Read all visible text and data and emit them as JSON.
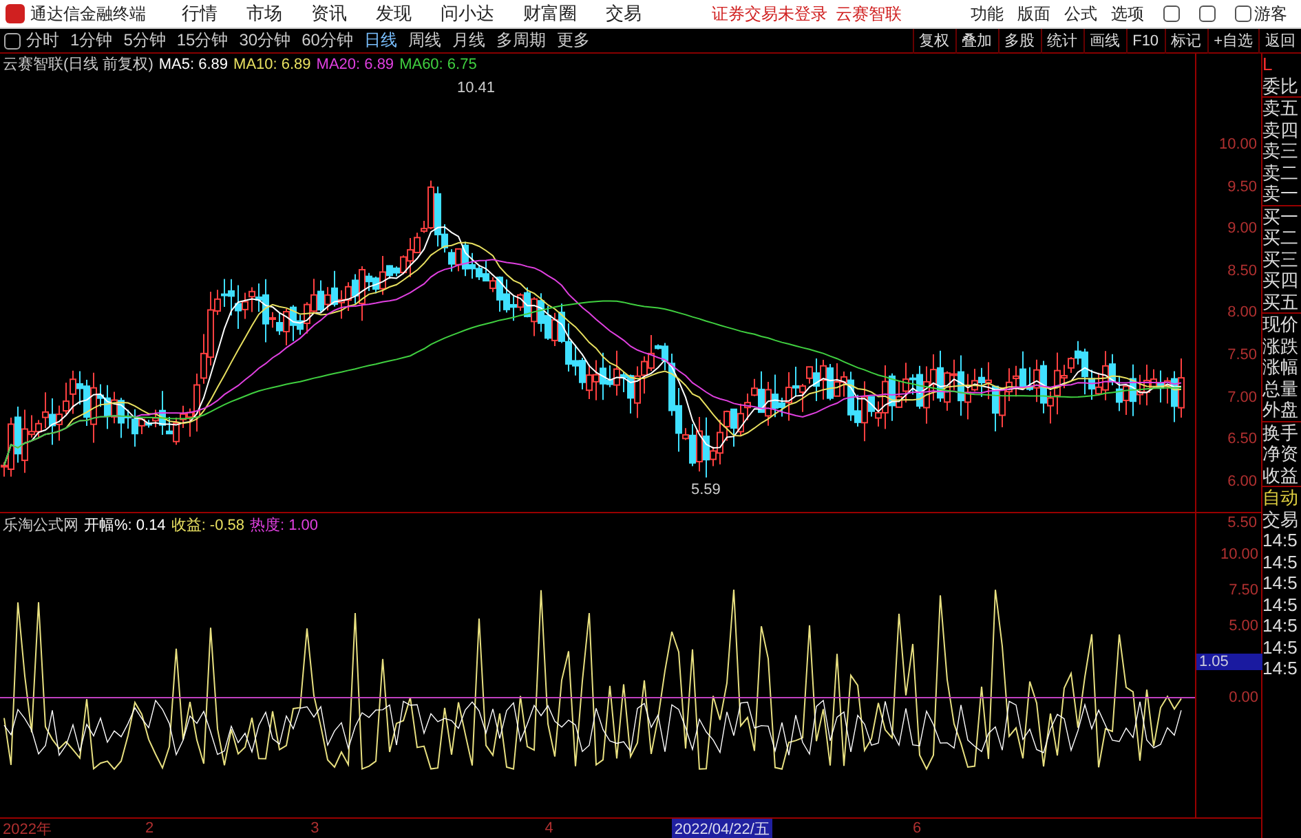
{
  "app": {
    "title": "通达信金融终端",
    "menu": [
      "行情",
      "市场",
      "资讯",
      "发现",
      "问小达",
      "财富圈",
      "交易"
    ],
    "notices": [
      "证券交易未登录",
      "云赛智联"
    ],
    "tools": [
      "功能",
      "版面",
      "公式",
      "选项"
    ],
    "user": "游客"
  },
  "toolbar": {
    "periods": [
      {
        "label": "分时",
        "selected": false
      },
      {
        "label": "1分钟",
        "selected": false
      },
      {
        "label": "5分钟",
        "selected": false
      },
      {
        "label": "15分钟",
        "selected": false
      },
      {
        "label": "30分钟",
        "selected": false
      },
      {
        "label": "60分钟",
        "selected": false
      },
      {
        "label": "日线",
        "selected": true
      },
      {
        "label": "周线",
        "selected": false
      },
      {
        "label": "月线",
        "selected": false
      },
      {
        "label": "多周期",
        "selected": false
      },
      {
        "label": "更多",
        "selected": false
      }
    ],
    "actions": [
      "复权",
      "叠加",
      "多股",
      "统计",
      "画线",
      "F10",
      "标记",
      "+自选",
      "返回"
    ]
  },
  "main_chart": {
    "title": "云赛智联(日线 前复权)",
    "legend": [
      {
        "label": "MA5: 6.89",
        "color": "#ffffff"
      },
      {
        "label": "MA10: 6.89",
        "color": "#e8e060"
      },
      {
        "label": "MA20: 6.89",
        "color": "#e040e0"
      },
      {
        "label": "MA60: 6.75",
        "color": "#40d040"
      }
    ],
    "high_label": "10.41",
    "low_label": "5.59",
    "axis": [
      "10.00",
      "9.50",
      "9.00",
      "8.50",
      "8.00",
      "7.50",
      "7.00",
      "6.50",
      "6.00",
      "5.50"
    ]
  },
  "indicator": {
    "title": "乐淘公式网",
    "legend": [
      {
        "label": "开幅%: 0.14",
        "color": "#ffffff"
      },
      {
        "label": "收益: -0.58",
        "color": "#e8e060"
      },
      {
        "label": "热度: 1.00",
        "color": "#e040e0"
      }
    ],
    "axis": [
      "10.00",
      "7.50",
      "5.00",
      "0.00"
    ],
    "current": "1.05"
  },
  "x_axis": [
    {
      "label": "2022年",
      "selected": false
    },
    {
      "label": "2",
      "selected": false
    },
    {
      "label": "3",
      "selected": false
    },
    {
      "label": "4",
      "selected": false
    },
    {
      "label": "2022/04/22/五",
      "selected": true
    },
    {
      "label": "6",
      "selected": false
    }
  ],
  "side_panel": {
    "corner": "L",
    "groups": [
      [
        "委比"
      ],
      [
        "卖五",
        "卖四",
        "卖三",
        "卖二",
        "卖一"
      ],
      [
        "买一",
        "买二",
        "买三",
        "买四",
        "买五"
      ],
      [
        "现价",
        "涨跌",
        "涨幅",
        "总量",
        "外盘"
      ],
      [
        "换手",
        "净资",
        "收益"
      ]
    ],
    "mode": "自动",
    "trades_title": "交易",
    "trades": [
      "14:5",
      "14:5",
      "14:5",
      "14:5",
      "14:5",
      "14:5",
      "14:5"
    ]
  }
}
